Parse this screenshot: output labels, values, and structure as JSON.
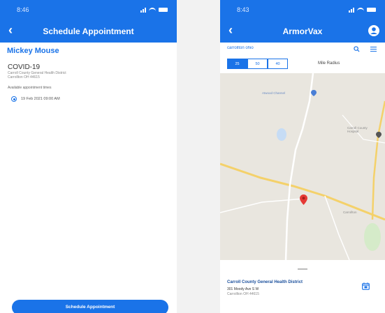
{
  "left_screen": {
    "status": {
      "time": "8:46"
    },
    "header": {
      "title": "Schedule Appointment"
    },
    "patient_name": "Mickey Mouse",
    "vaccine": "COVID-19",
    "site_name": "Carroll County General Health District",
    "site_city": "Carrollton OH 44615",
    "slots_label": "Available appointment times",
    "slots": [
      {
        "label": "19 Feb 2021 09:00 AM",
        "selected": true
      }
    ],
    "button_label": "Schedule Appointment"
  },
  "right_screen": {
    "status": {
      "time": "8:43"
    },
    "header": {
      "title": "ArmorVax"
    },
    "search": {
      "value": "carrollton ohio"
    },
    "radius": {
      "options": [
        "25",
        "50",
        "40"
      ],
      "selected": "25",
      "label": "Mile Radius"
    },
    "map": {
      "labels": [
        "Atwood Channel",
        "Carroll County Hospital",
        "Carrollton"
      ]
    },
    "location": {
      "name": "Carroll County General Health District",
      "address": "301 Moody Ave S W",
      "city": "Carrollton OH 44615"
    }
  },
  "colors": {
    "accent": "#1a73e8",
    "map_bg": "#e9e6df",
    "road": "#f4d16a",
    "pin": "#e53935"
  }
}
